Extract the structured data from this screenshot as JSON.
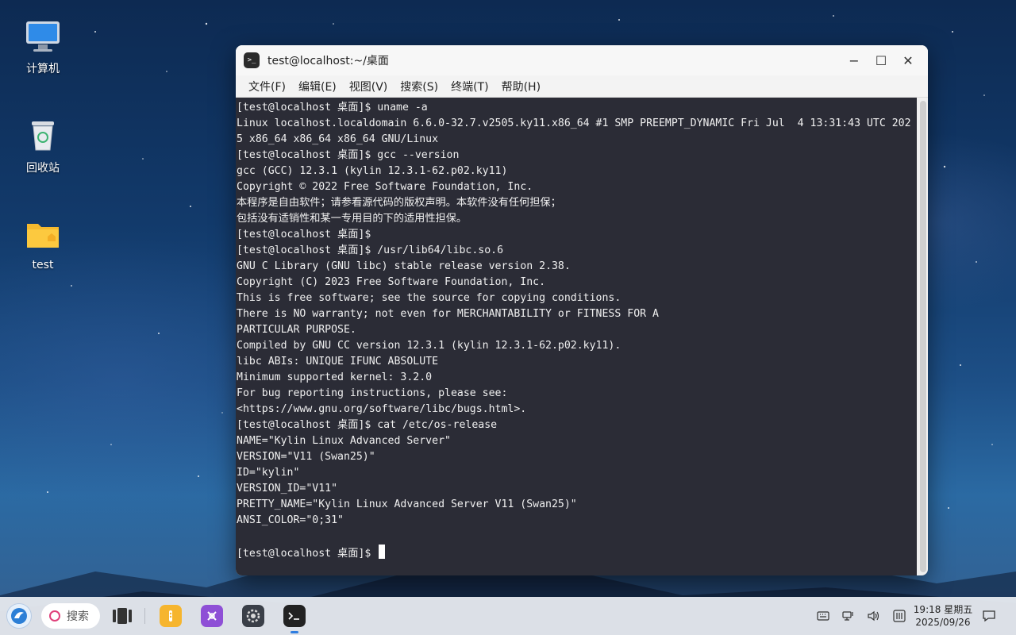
{
  "desktop": {
    "icons": [
      {
        "label": "计算机",
        "icon": "computer-icon"
      },
      {
        "label": "回收站",
        "icon": "trash-icon"
      },
      {
        "label": "test",
        "icon": "folder-icon"
      }
    ]
  },
  "window": {
    "title": "test@localhost:~/桌面",
    "controls": {
      "minimize": "−",
      "maximize": "☐",
      "close": "✕"
    },
    "menu": [
      "文件(F)",
      "编辑(E)",
      "视图(V)",
      "搜索(S)",
      "终端(T)",
      "帮助(H)"
    ]
  },
  "terminal": {
    "app_icon_text": ">_",
    "lines": [
      "[test@localhost 桌面]$ uname -a",
      "Linux localhost.localdomain 6.6.0-32.7.v2505.ky11.x86_64 #1 SMP PREEMPT_DYNAMIC Fri Jul  4 13:31:43 UTC 202",
      "5 x86_64 x86_64 x86_64 GNU/Linux",
      "[test@localhost 桌面]$ gcc --version",
      "gcc (GCC) 12.3.1 (kylin 12.3.1-62.p02.ky11)",
      "Copyright © 2022 Free Software Foundation, Inc.",
      "本程序是自由软件；请参看源代码的版权声明。本软件没有任何担保；",
      "包括没有适销性和某一专用目的下的适用性担保。",
      "[test@localhost 桌面]$",
      "[test@localhost 桌面]$ /usr/lib64/libc.so.6",
      "GNU C Library (GNU libc) stable release version 2.38.",
      "Copyright (C) 2023 Free Software Foundation, Inc.",
      "This is free software; see the source for copying conditions.",
      "There is NO warranty; not even for MERCHANTABILITY or FITNESS FOR A",
      "PARTICULAR PURPOSE.",
      "Compiled by GNU CC version 12.3.1 (kylin 12.3.1-62.p02.ky11).",
      "libc ABIs: UNIQUE IFUNC ABSOLUTE",
      "Minimum supported kernel: 3.2.0",
      "For bug reporting instructions, please see:",
      "<https://www.gnu.org/software/libc/bugs.html>.",
      "[test@localhost 桌面]$ cat /etc/os-release",
      "NAME=\"Kylin Linux Advanced Server\"",
      "VERSION=\"V11 (Swan25)\"",
      "ID=\"kylin\"",
      "VERSION_ID=\"V11\"",
      "PRETTY_NAME=\"Kylin Linux Advanced Server V11 (Swan25)\"",
      "ANSI_COLOR=\"0;31\"",
      "",
      "[test@localhost 桌面]$ "
    ]
  },
  "taskbar": {
    "search_label": "搜索",
    "apps": [
      "multitask-view-icon",
      "file-manager-icon",
      "app-store-icon",
      "settings-icon",
      "terminal-icon"
    ],
    "tray": [
      "keyboard-icon",
      "network-icon",
      "volume-icon",
      "control-center-icon"
    ],
    "clock": {
      "time": "19:18 星期五",
      "date": "2025/09/26"
    },
    "notification_icon": "notification-icon"
  },
  "colors": {
    "terminal_bg": "#2b2c36",
    "terminal_fg": "#f0f0f0",
    "search_accent": "#e0407a"
  }
}
